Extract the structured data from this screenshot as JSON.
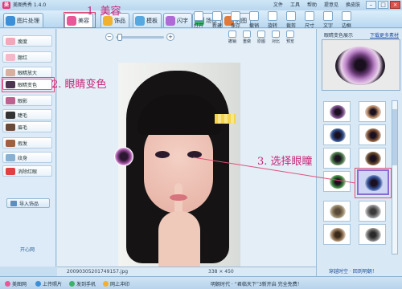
{
  "app": {
    "title": "美图秀秀 1.4.0",
    "logo_glyph": "美"
  },
  "menu": [
    "文件",
    "工具",
    "帮助",
    "提意见",
    "换皮肤"
  ],
  "window_controls": [
    "–",
    "□",
    "×"
  ],
  "tabs": [
    {
      "label": "图片处理",
      "color": "#3a8fd8"
    },
    {
      "label": "美容",
      "color": "#e85898"
    },
    {
      "label": "饰品",
      "color": "#f0b030"
    },
    {
      "label": "模板",
      "color": "#56a8e0"
    },
    {
      "label": "闪字",
      "color": "#b06ad8"
    },
    {
      "label": "场景",
      "color": "#3db06a"
    },
    {
      "label": "闪图",
      "color": "#e07a3a"
    }
  ],
  "right_tools": [
    "打开",
    "新建",
    "保存",
    "撤销",
    "旋转",
    "裁剪",
    "尺寸",
    "文字",
    "边框"
  ],
  "sidebar": {
    "items": [
      {
        "label": "瘦度",
        "color": "#f2a8b8"
      },
      {
        "label": "腮红",
        "color": "#f5b8c8"
      },
      {
        "label": "眼睛放大",
        "color": "#d9b0a0"
      },
      {
        "label": "眼睛变色",
        "color": "#4b3550"
      },
      {
        "label": "眼影",
        "color": "#c06090"
      },
      {
        "label": "睫毛",
        "color": "#333333"
      },
      {
        "label": "眉毛",
        "color": "#6a4b3a"
      },
      {
        "label": "假发",
        "color": "#a06040"
      },
      {
        "label": "纹身",
        "color": "#8ab0d0"
      },
      {
        "label": "消除红眼",
        "color": "#e04040"
      }
    ],
    "import_label": "导入饰品",
    "open_heart": "开心网"
  },
  "canvas_tools": [
    "撤销",
    "重做",
    "原图",
    "对比",
    "预览"
  ],
  "status": {
    "filename": "200903052017491​57.jpg",
    "dimensions": "338 × 450"
  },
  "right_panel": {
    "title": "眼睛变色展示",
    "link": "下载更多素材",
    "bottom_link": "穿越时空 · 回到明朝！",
    "swatches": [
      {
        "color": "#7a4a8a"
      },
      {
        "color": "#c0906a"
      },
      {
        "color": "#2f4f8f"
      },
      {
        "color": "#8a5a3a"
      },
      {
        "color": "#4a7a4a"
      },
      {
        "color": "#6a4a2a"
      },
      {
        "color": "#3a8a3a"
      },
      {
        "color": "#3a5aa8",
        "selected": true
      },
      {
        "color": "#9a8a6a"
      },
      {
        "color": "#8a8a8a"
      }
    ]
  },
  "annotations": {
    "step1": "1. 美容",
    "step2": "2. 眼睛变色",
    "step3": "3. 选择眼瞳"
  },
  "bottom_bar": [
    {
      "label": "美图网",
      "color": "#e85898"
    },
    {
      "label": "上传照片",
      "color": "#3a8fd8"
    },
    {
      "label": "发到手机",
      "color": "#3db06a"
    },
    {
      "label": "网上冲印",
      "color": "#f0b030"
    }
  ],
  "bottom_center": "明朝时代 · “君临天下”3新开启 完全免费！"
}
